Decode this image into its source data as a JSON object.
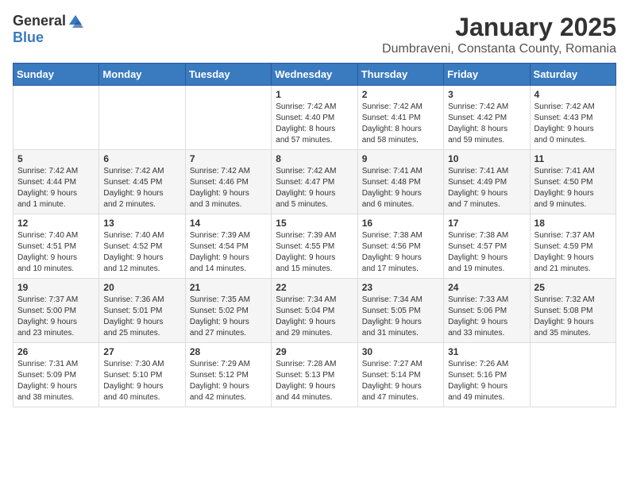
{
  "logo": {
    "general": "General",
    "blue": "Blue"
  },
  "header": {
    "month": "January 2025",
    "location": "Dumbraveni, Constanta County, Romania"
  },
  "weekdays": [
    "Sunday",
    "Monday",
    "Tuesday",
    "Wednesday",
    "Thursday",
    "Friday",
    "Saturday"
  ],
  "weeks": [
    [
      {
        "day": "",
        "info": ""
      },
      {
        "day": "",
        "info": ""
      },
      {
        "day": "",
        "info": ""
      },
      {
        "day": "1",
        "info": "Sunrise: 7:42 AM\nSunset: 4:40 PM\nDaylight: 8 hours\nand 57 minutes."
      },
      {
        "day": "2",
        "info": "Sunrise: 7:42 AM\nSunset: 4:41 PM\nDaylight: 8 hours\nand 58 minutes."
      },
      {
        "day": "3",
        "info": "Sunrise: 7:42 AM\nSunset: 4:42 PM\nDaylight: 8 hours\nand 59 minutes."
      },
      {
        "day": "4",
        "info": "Sunrise: 7:42 AM\nSunset: 4:43 PM\nDaylight: 9 hours\nand 0 minutes."
      }
    ],
    [
      {
        "day": "5",
        "info": "Sunrise: 7:42 AM\nSunset: 4:44 PM\nDaylight: 9 hours\nand 1 minute."
      },
      {
        "day": "6",
        "info": "Sunrise: 7:42 AM\nSunset: 4:45 PM\nDaylight: 9 hours\nand 2 minutes."
      },
      {
        "day": "7",
        "info": "Sunrise: 7:42 AM\nSunset: 4:46 PM\nDaylight: 9 hours\nand 3 minutes."
      },
      {
        "day": "8",
        "info": "Sunrise: 7:42 AM\nSunset: 4:47 PM\nDaylight: 9 hours\nand 5 minutes."
      },
      {
        "day": "9",
        "info": "Sunrise: 7:41 AM\nSunset: 4:48 PM\nDaylight: 9 hours\nand 6 minutes."
      },
      {
        "day": "10",
        "info": "Sunrise: 7:41 AM\nSunset: 4:49 PM\nDaylight: 9 hours\nand 7 minutes."
      },
      {
        "day": "11",
        "info": "Sunrise: 7:41 AM\nSunset: 4:50 PM\nDaylight: 9 hours\nand 9 minutes."
      }
    ],
    [
      {
        "day": "12",
        "info": "Sunrise: 7:40 AM\nSunset: 4:51 PM\nDaylight: 9 hours\nand 10 minutes."
      },
      {
        "day": "13",
        "info": "Sunrise: 7:40 AM\nSunset: 4:52 PM\nDaylight: 9 hours\nand 12 minutes."
      },
      {
        "day": "14",
        "info": "Sunrise: 7:39 AM\nSunset: 4:54 PM\nDaylight: 9 hours\nand 14 minutes."
      },
      {
        "day": "15",
        "info": "Sunrise: 7:39 AM\nSunset: 4:55 PM\nDaylight: 9 hours\nand 15 minutes."
      },
      {
        "day": "16",
        "info": "Sunrise: 7:38 AM\nSunset: 4:56 PM\nDaylight: 9 hours\nand 17 minutes."
      },
      {
        "day": "17",
        "info": "Sunrise: 7:38 AM\nSunset: 4:57 PM\nDaylight: 9 hours\nand 19 minutes."
      },
      {
        "day": "18",
        "info": "Sunrise: 7:37 AM\nSunset: 4:59 PM\nDaylight: 9 hours\nand 21 minutes."
      }
    ],
    [
      {
        "day": "19",
        "info": "Sunrise: 7:37 AM\nSunset: 5:00 PM\nDaylight: 9 hours\nand 23 minutes."
      },
      {
        "day": "20",
        "info": "Sunrise: 7:36 AM\nSunset: 5:01 PM\nDaylight: 9 hours\nand 25 minutes."
      },
      {
        "day": "21",
        "info": "Sunrise: 7:35 AM\nSunset: 5:02 PM\nDaylight: 9 hours\nand 27 minutes."
      },
      {
        "day": "22",
        "info": "Sunrise: 7:34 AM\nSunset: 5:04 PM\nDaylight: 9 hours\nand 29 minutes."
      },
      {
        "day": "23",
        "info": "Sunrise: 7:34 AM\nSunset: 5:05 PM\nDaylight: 9 hours\nand 31 minutes."
      },
      {
        "day": "24",
        "info": "Sunrise: 7:33 AM\nSunset: 5:06 PM\nDaylight: 9 hours\nand 33 minutes."
      },
      {
        "day": "25",
        "info": "Sunrise: 7:32 AM\nSunset: 5:08 PM\nDaylight: 9 hours\nand 35 minutes."
      }
    ],
    [
      {
        "day": "26",
        "info": "Sunrise: 7:31 AM\nSunset: 5:09 PM\nDaylight: 9 hours\nand 38 minutes."
      },
      {
        "day": "27",
        "info": "Sunrise: 7:30 AM\nSunset: 5:10 PM\nDaylight: 9 hours\nand 40 minutes."
      },
      {
        "day": "28",
        "info": "Sunrise: 7:29 AM\nSunset: 5:12 PM\nDaylight: 9 hours\nand 42 minutes."
      },
      {
        "day": "29",
        "info": "Sunrise: 7:28 AM\nSunset: 5:13 PM\nDaylight: 9 hours\nand 44 minutes."
      },
      {
        "day": "30",
        "info": "Sunrise: 7:27 AM\nSunset: 5:14 PM\nDaylight: 9 hours\nand 47 minutes."
      },
      {
        "day": "31",
        "info": "Sunrise: 7:26 AM\nSunset: 5:16 PM\nDaylight: 9 hours\nand 49 minutes."
      },
      {
        "day": "",
        "info": ""
      }
    ]
  ]
}
